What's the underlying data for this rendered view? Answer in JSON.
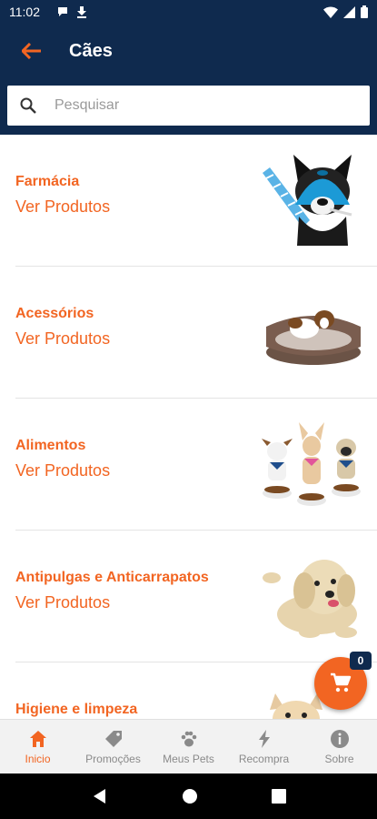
{
  "status_bar": {
    "time": "11:02"
  },
  "app_bar": {
    "title": "Cães"
  },
  "search": {
    "placeholder": "Pesquisar"
  },
  "categories": [
    {
      "name": "Farmácia",
      "link": "Ver Produtos"
    },
    {
      "name": "Acessórios",
      "link": "Ver Produtos"
    },
    {
      "name": "Alimentos",
      "link": "Ver Produtos"
    },
    {
      "name": "Antipulgas e Anticarrapatos",
      "link": "Ver Produtos"
    },
    {
      "name": "Higiene e limpeza",
      "link": ""
    }
  ],
  "cart": {
    "count": "0"
  },
  "bottom_nav": [
    {
      "label": "Inicio",
      "icon": "home-icon",
      "active": true
    },
    {
      "label": "Promoções",
      "icon": "tag-icon"
    },
    {
      "label": "Meus Pets",
      "icon": "paw-icon"
    },
    {
      "label": "Recompra",
      "icon": "lightning-icon"
    },
    {
      "label": "Sobre",
      "icon": "info-icon"
    }
  ],
  "colors": {
    "primary": "#0f2a4e",
    "accent": "#f26522"
  }
}
